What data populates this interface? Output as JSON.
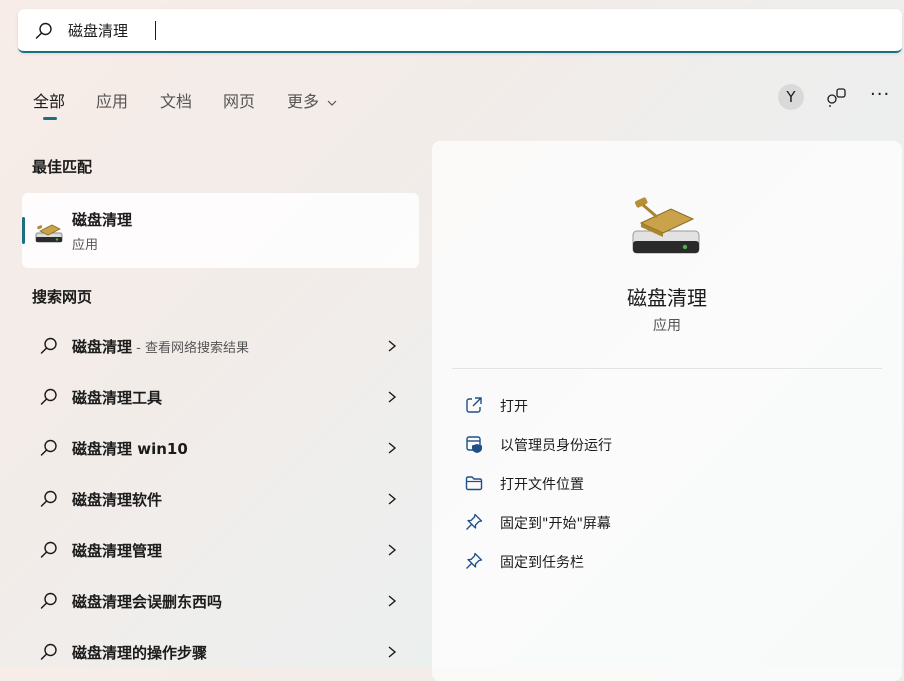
{
  "search": {
    "query": "磁盘清理"
  },
  "tabs": [
    {
      "label": "全部",
      "active": true
    },
    {
      "label": "应用"
    },
    {
      "label": "文档"
    },
    {
      "label": "网页"
    },
    {
      "label": "更多"
    }
  ],
  "header_tools": {
    "avatar_letter": "Y",
    "more_label": "···"
  },
  "best_match": {
    "title": "最佳匹配",
    "name": "磁盘清理",
    "type": "应用"
  },
  "web_search": {
    "title": "搜索网页",
    "items": [
      {
        "text": "磁盘清理",
        "sub": " - 查看网络搜索结果"
      },
      {
        "text": "磁盘清理工具",
        "sub": ""
      },
      {
        "text": "磁盘清理 win10",
        "sub": ""
      },
      {
        "text": "磁盘清理软件",
        "sub": ""
      },
      {
        "text": "磁盘清理管理",
        "sub": ""
      },
      {
        "text": "磁盘清理会误删东西吗",
        "sub": ""
      },
      {
        "text": "磁盘清理的操作步骤",
        "sub": ""
      }
    ]
  },
  "detail": {
    "name": "磁盘清理",
    "type": "应用",
    "actions": [
      {
        "label": "打开",
        "icon": "open-external-icon"
      },
      {
        "label": "以管理员身份运行",
        "icon": "admin-shield-icon"
      },
      {
        "label": "打开文件位置",
        "icon": "folder-icon"
      },
      {
        "label": "固定到\"开始\"屏幕",
        "icon": "pin-icon"
      },
      {
        "label": "固定到任务栏",
        "icon": "pin-icon"
      }
    ]
  },
  "colors": {
    "accent": "#1d6f7f"
  }
}
